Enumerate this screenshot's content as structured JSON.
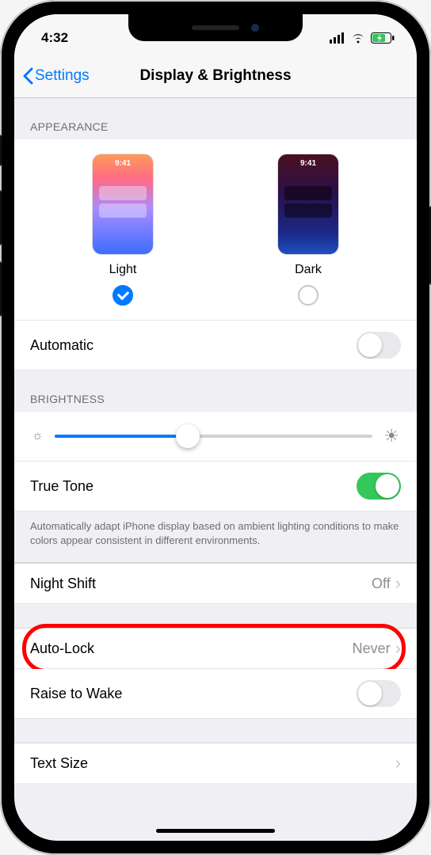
{
  "status": {
    "time": "4:32"
  },
  "nav": {
    "back": "Settings",
    "title": "Display & Brightness"
  },
  "sections": {
    "appearance_header": "Appearance",
    "brightness_header": "Brightness"
  },
  "appearance": {
    "light_label": "Light",
    "dark_label": "Dark",
    "thumb_time": "9:41",
    "selected": "light",
    "automatic_label": "Automatic",
    "automatic_on": false
  },
  "brightness": {
    "value_percent": 42,
    "truetone_label": "True Tone",
    "truetone_on": true,
    "truetone_footer": "Automatically adapt iPhone display based on ambient lighting conditions to make colors appear consistent in different environments."
  },
  "rows": {
    "night_shift": {
      "label": "Night Shift",
      "value": "Off"
    },
    "auto_lock": {
      "label": "Auto-Lock",
      "value": "Never"
    },
    "raise": {
      "label": "Raise to Wake",
      "on": false
    },
    "text_size": {
      "label": "Text Size"
    }
  },
  "colors": {
    "accent": "#007aff",
    "toggle_on": "#34c759",
    "highlight": "#ff0000"
  }
}
